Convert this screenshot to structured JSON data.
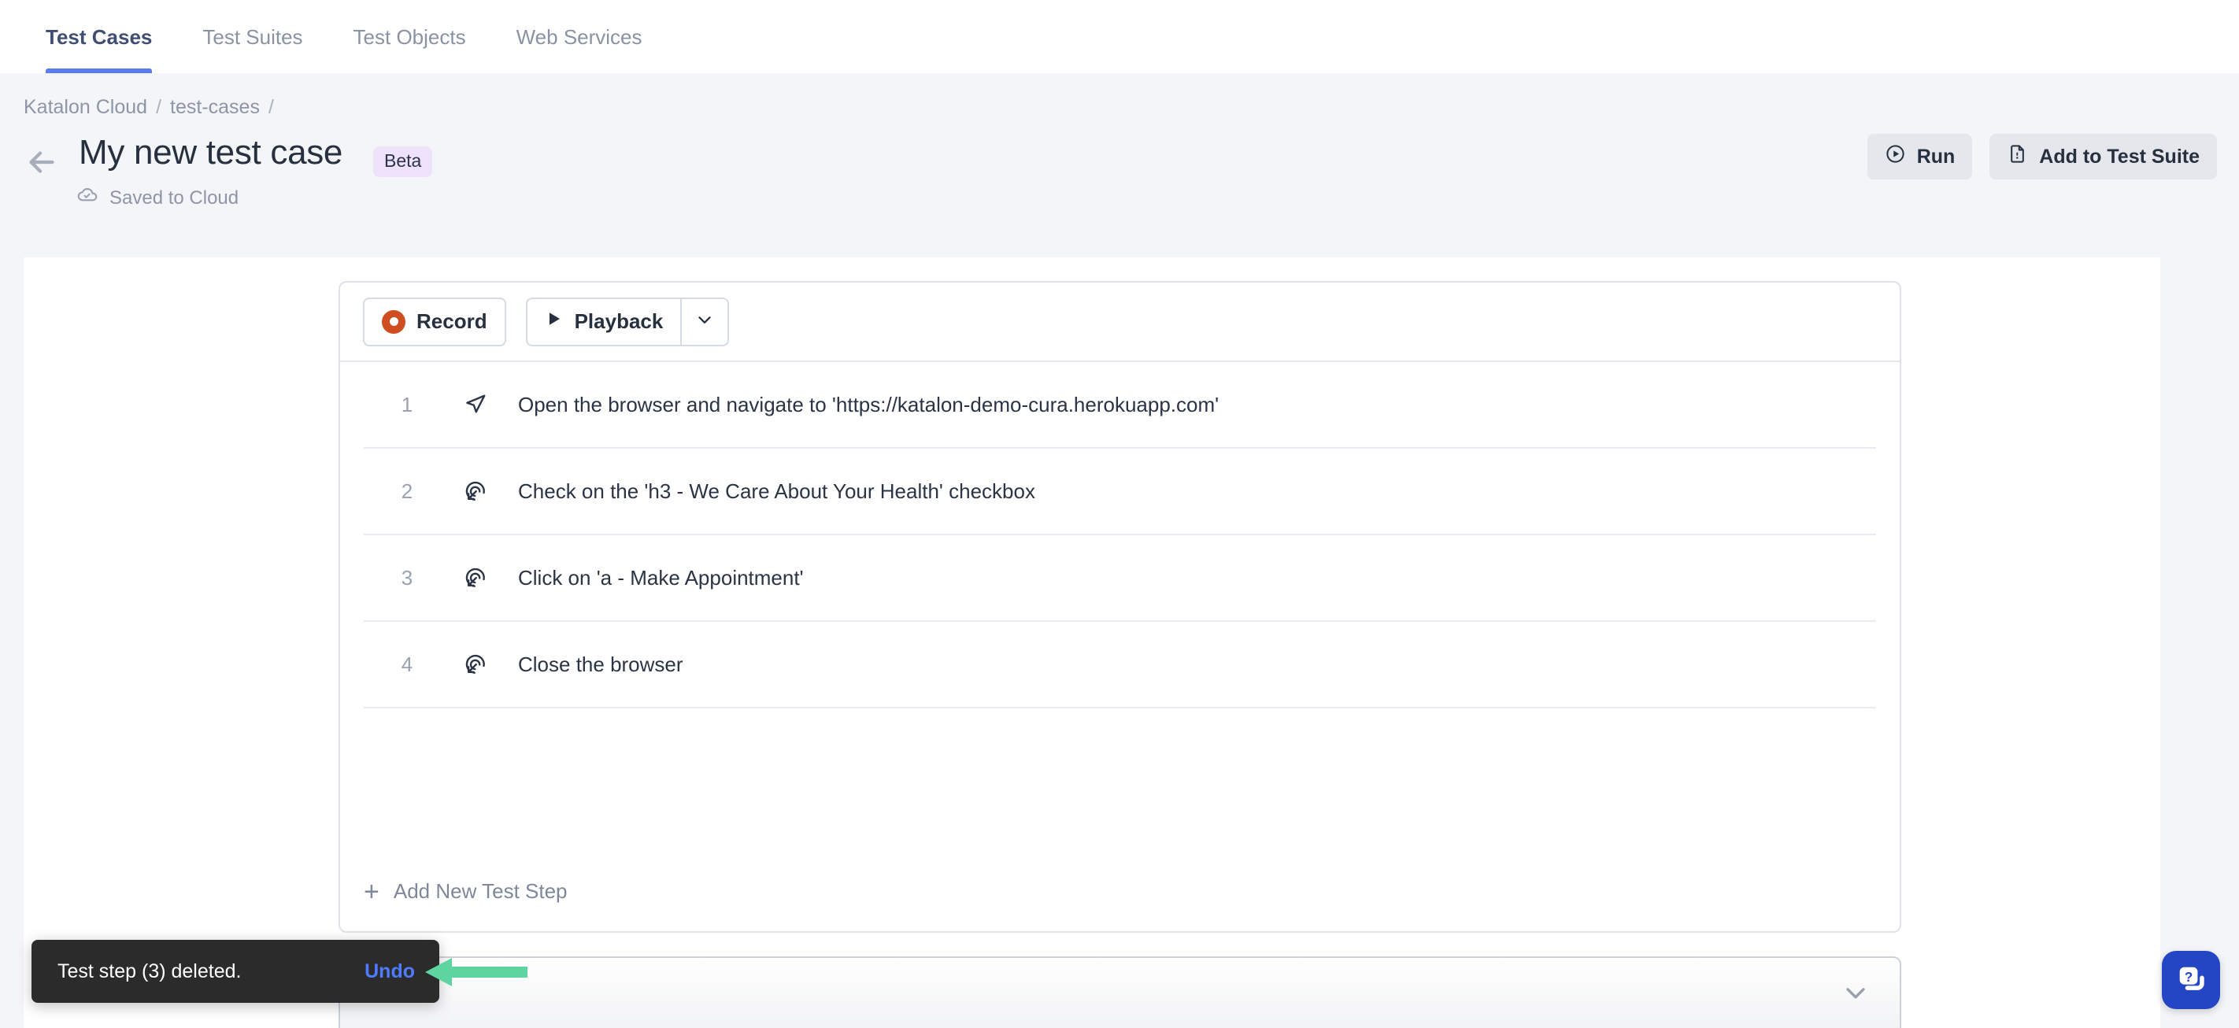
{
  "tabs": [
    {
      "label": "Test Cases",
      "active": true
    },
    {
      "label": "Test Suites",
      "active": false
    },
    {
      "label": "Test Objects",
      "active": false
    },
    {
      "label": "Web Services",
      "active": false
    }
  ],
  "breadcrumb": {
    "items": [
      "Katalon Cloud",
      "test-cases"
    ],
    "separator": "/",
    "trailing_separator": "/"
  },
  "header": {
    "title": "My new test case",
    "badge": "Beta",
    "save_status": "Saved to Cloud",
    "back_icon": "arrow-left-icon",
    "cloud_icon": "cloud-check-icon",
    "actions": [
      {
        "label": "Run",
        "icon": "play-circle-icon"
      },
      {
        "label": "Add to Test Suite",
        "icon": "document-icon"
      }
    ]
  },
  "toolbar": {
    "record_label": "Record",
    "record_icon": "record-dot-icon",
    "playback_label": "Playback",
    "playback_icon": "play-triangle-icon",
    "playback_caret_icon": "chevron-down-icon"
  },
  "steps": [
    {
      "num": "1",
      "icon": "navigate-icon",
      "text": "Open the browser and navigate to 'https://katalon-demo-cura.herokuapp.com'"
    },
    {
      "num": "2",
      "icon": "cursor-click-icon",
      "text": "Check on the 'h3 - We Care About Your Health' checkbox"
    },
    {
      "num": "3",
      "icon": "cursor-click-icon",
      "text": "Click on 'a - Make Appointment'"
    },
    {
      "num": "4",
      "icon": "cursor-click-icon",
      "text": "Close the browser"
    }
  ],
  "add_step": {
    "label": "Add New Test Step",
    "icon": "plus-icon"
  },
  "bottom_panel": {
    "expand_icon": "chevron-down-icon"
  },
  "toast": {
    "message": "Test step (3) deleted.",
    "action_label": "Undo"
  },
  "annotation": {
    "type": "arrow-left",
    "color": "#5ed4a0",
    "points_to": "Undo"
  },
  "help_widget": {
    "icon": "question-chat-icon",
    "color": "#2546c4"
  },
  "colors": {
    "accent": "#5b7bf0",
    "record": "#cf4d20",
    "badge_bg": "#eee2fa",
    "toast_bg": "#2b2b2b",
    "undo_link": "#4f7bff",
    "annotation_green": "#5ed4a0",
    "page_bg": "#f4f5f8"
  }
}
